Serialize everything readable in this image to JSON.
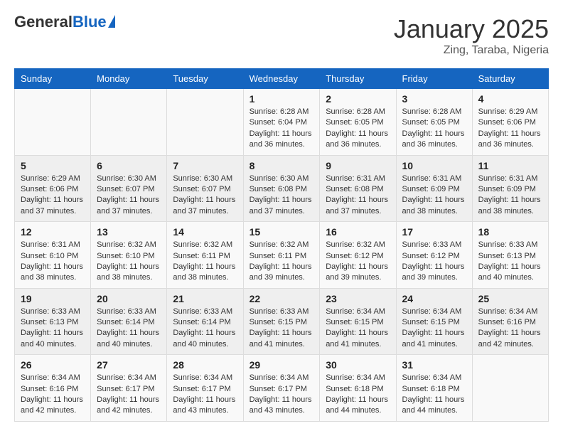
{
  "logo": {
    "general": "General",
    "blue": "Blue"
  },
  "header": {
    "title": "January 2025",
    "subtitle": "Zing, Taraba, Nigeria"
  },
  "weekdays": [
    "Sunday",
    "Monday",
    "Tuesday",
    "Wednesday",
    "Thursday",
    "Friday",
    "Saturday"
  ],
  "weeks": [
    [
      {
        "day": "",
        "sunrise": "",
        "sunset": "",
        "daylight": ""
      },
      {
        "day": "",
        "sunrise": "",
        "sunset": "",
        "daylight": ""
      },
      {
        "day": "",
        "sunrise": "",
        "sunset": "",
        "daylight": ""
      },
      {
        "day": "1",
        "sunrise": "Sunrise: 6:28 AM",
        "sunset": "Sunset: 6:04 PM",
        "daylight": "Daylight: 11 hours and 36 minutes."
      },
      {
        "day": "2",
        "sunrise": "Sunrise: 6:28 AM",
        "sunset": "Sunset: 6:05 PM",
        "daylight": "Daylight: 11 hours and 36 minutes."
      },
      {
        "day": "3",
        "sunrise": "Sunrise: 6:28 AM",
        "sunset": "Sunset: 6:05 PM",
        "daylight": "Daylight: 11 hours and 36 minutes."
      },
      {
        "day": "4",
        "sunrise": "Sunrise: 6:29 AM",
        "sunset": "Sunset: 6:06 PM",
        "daylight": "Daylight: 11 hours and 36 minutes."
      }
    ],
    [
      {
        "day": "5",
        "sunrise": "Sunrise: 6:29 AM",
        "sunset": "Sunset: 6:06 PM",
        "daylight": "Daylight: 11 hours and 37 minutes."
      },
      {
        "day": "6",
        "sunrise": "Sunrise: 6:30 AM",
        "sunset": "Sunset: 6:07 PM",
        "daylight": "Daylight: 11 hours and 37 minutes."
      },
      {
        "day": "7",
        "sunrise": "Sunrise: 6:30 AM",
        "sunset": "Sunset: 6:07 PM",
        "daylight": "Daylight: 11 hours and 37 minutes."
      },
      {
        "day": "8",
        "sunrise": "Sunrise: 6:30 AM",
        "sunset": "Sunset: 6:08 PM",
        "daylight": "Daylight: 11 hours and 37 minutes."
      },
      {
        "day": "9",
        "sunrise": "Sunrise: 6:31 AM",
        "sunset": "Sunset: 6:08 PM",
        "daylight": "Daylight: 11 hours and 37 minutes."
      },
      {
        "day": "10",
        "sunrise": "Sunrise: 6:31 AM",
        "sunset": "Sunset: 6:09 PM",
        "daylight": "Daylight: 11 hours and 38 minutes."
      },
      {
        "day": "11",
        "sunrise": "Sunrise: 6:31 AM",
        "sunset": "Sunset: 6:09 PM",
        "daylight": "Daylight: 11 hours and 38 minutes."
      }
    ],
    [
      {
        "day": "12",
        "sunrise": "Sunrise: 6:31 AM",
        "sunset": "Sunset: 6:10 PM",
        "daylight": "Daylight: 11 hours and 38 minutes."
      },
      {
        "day": "13",
        "sunrise": "Sunrise: 6:32 AM",
        "sunset": "Sunset: 6:10 PM",
        "daylight": "Daylight: 11 hours and 38 minutes."
      },
      {
        "day": "14",
        "sunrise": "Sunrise: 6:32 AM",
        "sunset": "Sunset: 6:11 PM",
        "daylight": "Daylight: 11 hours and 38 minutes."
      },
      {
        "day": "15",
        "sunrise": "Sunrise: 6:32 AM",
        "sunset": "Sunset: 6:11 PM",
        "daylight": "Daylight: 11 hours and 39 minutes."
      },
      {
        "day": "16",
        "sunrise": "Sunrise: 6:32 AM",
        "sunset": "Sunset: 6:12 PM",
        "daylight": "Daylight: 11 hours and 39 minutes."
      },
      {
        "day": "17",
        "sunrise": "Sunrise: 6:33 AM",
        "sunset": "Sunset: 6:12 PM",
        "daylight": "Daylight: 11 hours and 39 minutes."
      },
      {
        "day": "18",
        "sunrise": "Sunrise: 6:33 AM",
        "sunset": "Sunset: 6:13 PM",
        "daylight": "Daylight: 11 hours and 40 minutes."
      }
    ],
    [
      {
        "day": "19",
        "sunrise": "Sunrise: 6:33 AM",
        "sunset": "Sunset: 6:13 PM",
        "daylight": "Daylight: 11 hours and 40 minutes."
      },
      {
        "day": "20",
        "sunrise": "Sunrise: 6:33 AM",
        "sunset": "Sunset: 6:14 PM",
        "daylight": "Daylight: 11 hours and 40 minutes."
      },
      {
        "day": "21",
        "sunrise": "Sunrise: 6:33 AM",
        "sunset": "Sunset: 6:14 PM",
        "daylight": "Daylight: 11 hours and 40 minutes."
      },
      {
        "day": "22",
        "sunrise": "Sunrise: 6:33 AM",
        "sunset": "Sunset: 6:15 PM",
        "daylight": "Daylight: 11 hours and 41 minutes."
      },
      {
        "day": "23",
        "sunrise": "Sunrise: 6:34 AM",
        "sunset": "Sunset: 6:15 PM",
        "daylight": "Daylight: 11 hours and 41 minutes."
      },
      {
        "day": "24",
        "sunrise": "Sunrise: 6:34 AM",
        "sunset": "Sunset: 6:15 PM",
        "daylight": "Daylight: 11 hours and 41 minutes."
      },
      {
        "day": "25",
        "sunrise": "Sunrise: 6:34 AM",
        "sunset": "Sunset: 6:16 PM",
        "daylight": "Daylight: 11 hours and 42 minutes."
      }
    ],
    [
      {
        "day": "26",
        "sunrise": "Sunrise: 6:34 AM",
        "sunset": "Sunset: 6:16 PM",
        "daylight": "Daylight: 11 hours and 42 minutes."
      },
      {
        "day": "27",
        "sunrise": "Sunrise: 6:34 AM",
        "sunset": "Sunset: 6:17 PM",
        "daylight": "Daylight: 11 hours and 42 minutes."
      },
      {
        "day": "28",
        "sunrise": "Sunrise: 6:34 AM",
        "sunset": "Sunset: 6:17 PM",
        "daylight": "Daylight: 11 hours and 43 minutes."
      },
      {
        "day": "29",
        "sunrise": "Sunrise: 6:34 AM",
        "sunset": "Sunset: 6:17 PM",
        "daylight": "Daylight: 11 hours and 43 minutes."
      },
      {
        "day": "30",
        "sunrise": "Sunrise: 6:34 AM",
        "sunset": "Sunset: 6:18 PM",
        "daylight": "Daylight: 11 hours and 44 minutes."
      },
      {
        "day": "31",
        "sunrise": "Sunrise: 6:34 AM",
        "sunset": "Sunset: 6:18 PM",
        "daylight": "Daylight: 11 hours and 44 minutes."
      },
      {
        "day": "",
        "sunrise": "",
        "sunset": "",
        "daylight": ""
      }
    ]
  ]
}
